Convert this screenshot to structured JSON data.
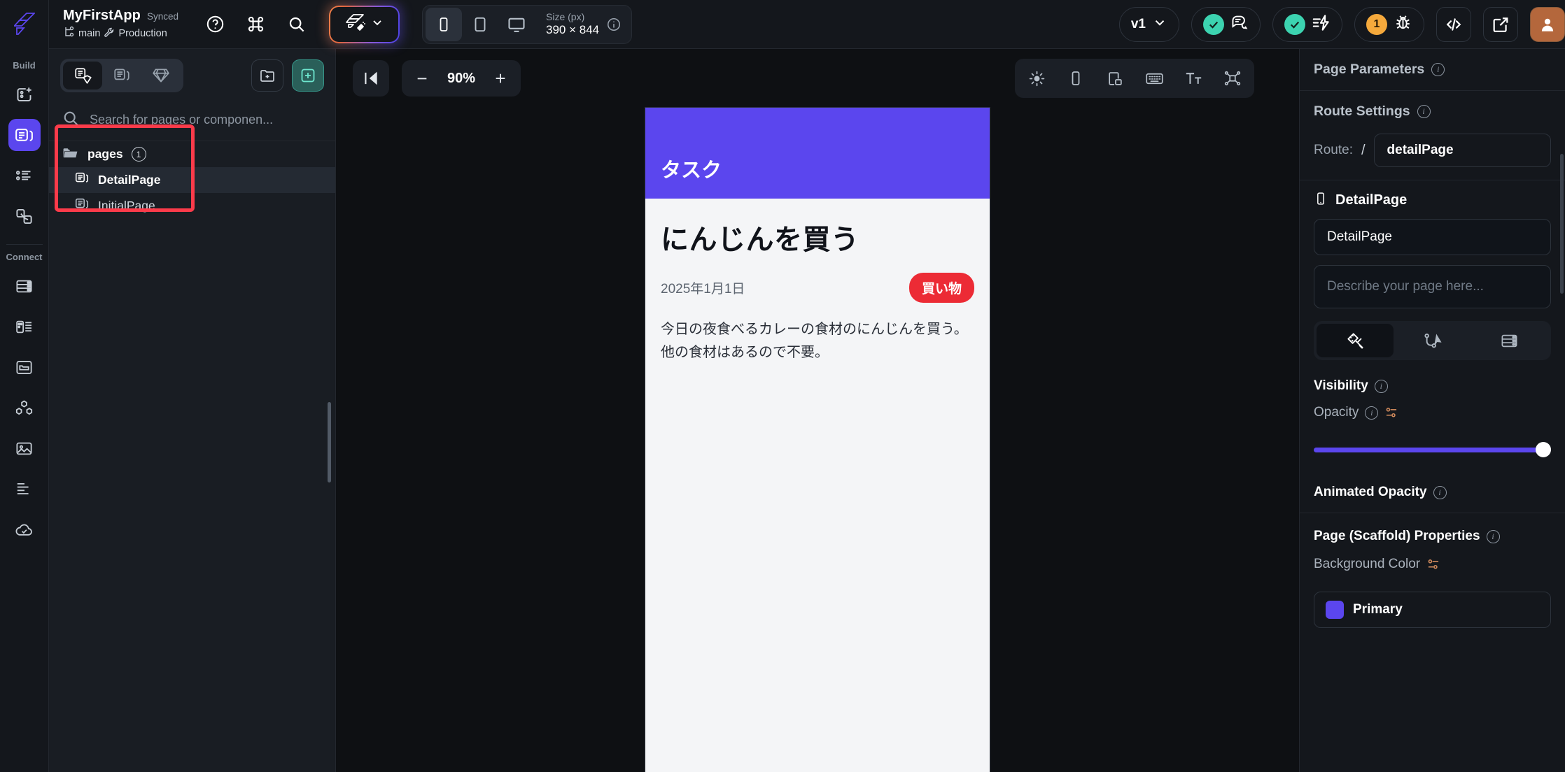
{
  "header": {
    "logo_icon": "flutterflow-logo-icon",
    "app_name": "MyFirstApp",
    "sync_status": "Synced",
    "branch_icon": "branch-icon",
    "branch_name": "main",
    "env_icon": "wrench-icon",
    "env_name": "Production",
    "icons": [
      "help-circle-icon",
      "command-icon",
      "search-icon"
    ],
    "ai_button": {
      "icon": "ai-magic-icon",
      "chevron": "chevron-down-icon"
    },
    "devices": [
      {
        "name": "phone",
        "active": true
      },
      {
        "name": "tablet",
        "active": false
      },
      {
        "name": "desktop",
        "active": false
      }
    ],
    "size_label": "Size (px)",
    "size_value": "390 × 844",
    "version_label": "v1",
    "comments_badge": "check",
    "actions_badge": "check",
    "issues_count": "1",
    "buttons": [
      "code-icon",
      "open-external-icon",
      "user-avatar"
    ]
  },
  "rail": {
    "build_label": "Build",
    "build_items": [
      {
        "name": "add-component",
        "active": false
      },
      {
        "name": "pages",
        "active": true
      },
      {
        "name": "components-list",
        "active": false
      },
      {
        "name": "widget-link",
        "active": false
      }
    ],
    "connect_label": "Connect",
    "connect_items": [
      {
        "name": "database",
        "active": false
      },
      {
        "name": "schema",
        "active": false
      },
      {
        "name": "folder",
        "active": false
      },
      {
        "name": "integrations",
        "active": false
      },
      {
        "name": "media",
        "active": false
      },
      {
        "name": "text-styles",
        "active": false
      },
      {
        "name": "deploy",
        "active": false
      }
    ]
  },
  "pages_panel": {
    "segments": [
      {
        "name": "pages-and-components",
        "active": true
      },
      {
        "name": "components",
        "active": false
      },
      {
        "name": "design-system",
        "active": false
      }
    ],
    "new_folder_label": "new-folder-icon",
    "new_page_label": "new-page-icon",
    "search_placeholder": "Search for pages or componen...",
    "search_value": "",
    "tree": {
      "folder_label": "pages",
      "folder_count": "1",
      "items": [
        {
          "label": "DetailPage",
          "selected": true
        },
        {
          "label": "InitialPage",
          "selected": false
        }
      ]
    }
  },
  "canvas": {
    "collapse_icon": "collapse-panel-icon",
    "zoom_out": "−",
    "zoom_value": "90%",
    "zoom_in": "+",
    "tools": [
      {
        "name": "theme-brightness",
        "active": false
      },
      {
        "name": "device-frame",
        "active": false
      },
      {
        "name": "responsive-layout",
        "active": false
      },
      {
        "name": "keyboard",
        "active": false
      },
      {
        "name": "text-scale",
        "active": false
      },
      {
        "name": "widget-tree",
        "active": false
      }
    ],
    "preview": {
      "appbar_title": "タスク",
      "task_title": "にんじんを買う",
      "task_date": "2025年1月1日",
      "tag": "買い物",
      "description": "今日の夜食べるカレーの食材のにんじんを買う。他の食材はあるので不要。",
      "appbar_color": "#5b46ee",
      "tag_color": "#ec2b35"
    }
  },
  "right_panel": {
    "page_parameters_title": "Page Parameters",
    "route_settings_title": "Route Settings",
    "route_label": "Route:",
    "route_slash": "/",
    "route_value": "detailPage",
    "page_icon": "phone-icon",
    "page_name_heading": "DetailPage",
    "page_name_value": "DetailPage",
    "description_placeholder": "Describe your page here...",
    "tabs": [
      {
        "name": "design",
        "active": true
      },
      {
        "name": "actions",
        "active": false
      },
      {
        "name": "backend",
        "active": false
      }
    ],
    "visibility_label": "Visibility",
    "opacity_label": "Opacity",
    "opacity_value": 100,
    "animated_opacity_label": "Animated Opacity",
    "scaffold_title": "Page (Scaffold) Properties",
    "background_color_label": "Background Color",
    "background_color_name": "Primary",
    "background_color_hex": "#5b46ee"
  }
}
